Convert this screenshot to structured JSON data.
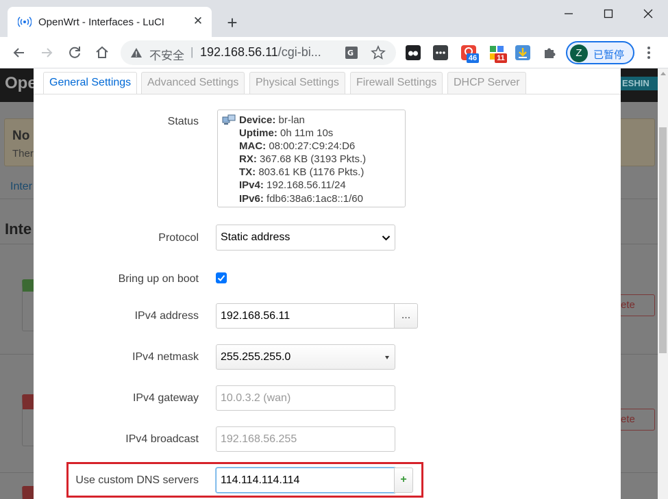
{
  "browser": {
    "tab_title": "OpenWrt - Interfaces - LuCI",
    "omnibox": {
      "security_label": "不安全",
      "separator": "|",
      "url_host": "192.168.56.11",
      "url_path": "/cgi-bi..."
    },
    "extensions": [
      {
        "name": "extension-ghost-icon"
      },
      {
        "name": "extension-dots-icon"
      },
      {
        "name": "extension-red-icon",
        "badge": "46",
        "badge_color": "#1a73e8"
      },
      {
        "name": "extension-grid-icon",
        "badge": "11",
        "badge_color": "#d93025"
      },
      {
        "name": "extension-download-icon"
      },
      {
        "name": "extensions-puzzle-icon"
      }
    ],
    "profile": {
      "initial": "Z",
      "label": "已暂停"
    }
  },
  "background": {
    "brand": "Ope",
    "hostname": "ESHIN",
    "alert_title": "No",
    "alert_text": "Ther",
    "breadcrumb": "Inter",
    "heading": "Inte",
    "delete_label": "ete"
  },
  "modal": {
    "tabs": [
      "General Settings",
      "Advanced Settings",
      "Physical Settings",
      "Firewall Settings",
      "DHCP Server"
    ],
    "active_tab": "General Settings",
    "status": {
      "label": "Status",
      "rows": [
        {
          "key": "Device:",
          "value": "br-lan"
        },
        {
          "key": "Uptime:",
          "value": "0h 11m 10s"
        },
        {
          "key": "MAC:",
          "value": "08:00:27:C9:24:D6"
        },
        {
          "key": "RX:",
          "value": "367.68 KB (3193 Pkts.)"
        },
        {
          "key": "TX:",
          "value": "803.61 KB (1176 Pkts.)"
        },
        {
          "key": "IPv4:",
          "value": "192.168.56.11/24"
        },
        {
          "key": "IPv6:",
          "value": "fdb6:38a6:1ac8::1/60"
        }
      ]
    },
    "protocol": {
      "label": "Protocol",
      "value": "Static address"
    },
    "boot": {
      "label": "Bring up on boot",
      "checked": true
    },
    "ipv4_address": {
      "label": "IPv4 address",
      "value": "192.168.56.11",
      "button": "..."
    },
    "ipv4_netmask": {
      "label": "IPv4 netmask",
      "value": "255.255.255.0"
    },
    "ipv4_gateway": {
      "label": "IPv4 gateway",
      "placeholder": "10.0.3.2 (wan)"
    },
    "ipv4_broadcast": {
      "label": "IPv4 broadcast",
      "placeholder": "192.168.56.255"
    },
    "dns": {
      "label": "Use custom DNS servers",
      "value": "114.114.114.114",
      "button": "+"
    }
  },
  "colors": {
    "accent": "#0069d6",
    "highlight": "#d6232b",
    "add_button": "#3a9a3a",
    "checkbox": "#0075ff"
  }
}
